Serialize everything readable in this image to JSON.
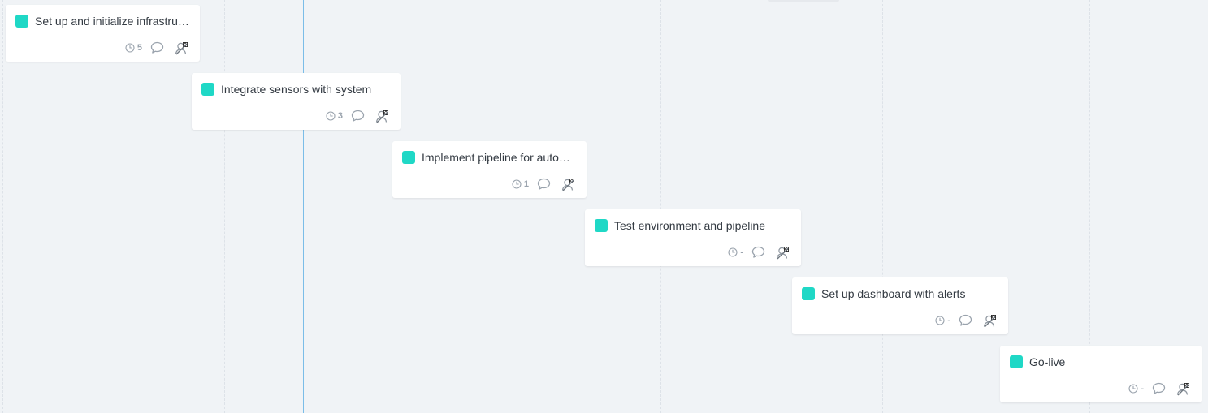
{
  "colors": {
    "background": "#f0f3f6",
    "card_bg": "#ffffff",
    "task_color": "#1fd8c6",
    "today_line": "#7bbde8",
    "meta_gray": "#9aa3ad",
    "title_text": "#333a42"
  },
  "tasks": [
    {
      "title": "Set up and initialize infrastructure",
      "estimate": "5",
      "color": "#1fd8c6"
    },
    {
      "title": "Integrate sensors with system",
      "estimate": "3",
      "color": "#1fd8c6"
    },
    {
      "title": "Implement pipeline for automation",
      "estimate": "1",
      "color": "#1fd8c6"
    },
    {
      "title": "Test environment and pipeline",
      "estimate": "-",
      "color": "#1fd8c6"
    },
    {
      "title": "Set up dashboard with alerts",
      "estimate": "-",
      "color": "#1fd8c6"
    },
    {
      "title": "Go-live",
      "estimate": "-",
      "color": "#1fd8c6"
    }
  ],
  "icons": {
    "estimate": "clock-icon",
    "comments": "comment-bubble-icon",
    "assignee": "unassigned-user-icon"
  }
}
